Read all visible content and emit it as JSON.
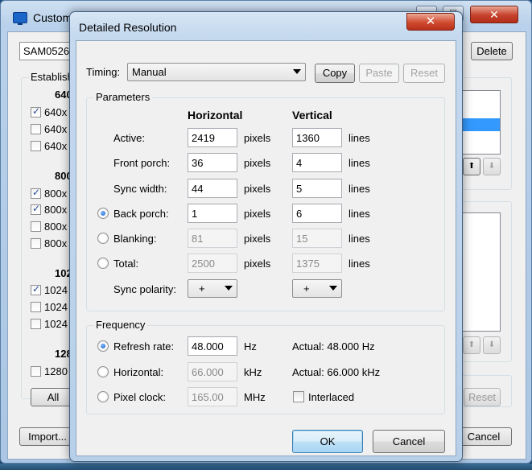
{
  "background_window": {
    "title": "Custom",
    "monitor_combo": "SAM0526",
    "delete_label": "Delete",
    "established_label": "Establish",
    "sections": [
      {
        "heading": "640",
        "items": [
          {
            "label": "640x",
            "checked": true
          },
          {
            "label": "640x",
            "checked": false
          },
          {
            "label": "640x",
            "checked": false
          }
        ]
      },
      {
        "heading": "800",
        "items": [
          {
            "label": "800x",
            "checked": true
          },
          {
            "label": "800x",
            "checked": true
          },
          {
            "label": "800x",
            "checked": false
          },
          {
            "label": "800x",
            "checked": false
          }
        ]
      },
      {
        "heading": "102",
        "items": [
          {
            "label": "1024",
            "checked": true
          },
          {
            "label": "1024",
            "checked": false
          },
          {
            "label": "1024",
            "checked": false
          }
        ]
      },
      {
        "heading": "128",
        "items": [
          {
            "label": "1280",
            "checked": false
          }
        ]
      }
    ],
    "all_label": "All",
    "reset_label": "Reset",
    "import_label": "Import...",
    "cancel_label": "Cancel",
    "up_arrow": "⬆",
    "down_arrow": "⬇"
  },
  "dialog": {
    "title": "Detailed Resolution",
    "close_glyph": "✕",
    "timing": {
      "label": "Timing:",
      "value": "Manual"
    },
    "copy_label": "Copy",
    "paste_label": "Paste",
    "reset_label": "Reset",
    "parameters": {
      "group_label": "Parameters",
      "horizontal_header": "Horizontal",
      "vertical_header": "Vertical",
      "rows": [
        {
          "label": "Active:",
          "h": "2419",
          "h_unit": "pixels",
          "v": "1360",
          "v_unit": "lines",
          "editable": true,
          "radio": null
        },
        {
          "label": "Front porch:",
          "h": "36",
          "h_unit": "pixels",
          "v": "4",
          "v_unit": "lines",
          "editable": true,
          "radio": null
        },
        {
          "label": "Sync width:",
          "h": "44",
          "h_unit": "pixels",
          "v": "5",
          "v_unit": "lines",
          "editable": true,
          "radio": null
        },
        {
          "label": "Back porch:",
          "h": "1",
          "h_unit": "pixels",
          "v": "6",
          "v_unit": "lines",
          "editable": true,
          "radio": "on"
        },
        {
          "label": "Blanking:",
          "h": "81",
          "h_unit": "pixels",
          "v": "15",
          "v_unit": "lines",
          "editable": false,
          "radio": "off"
        },
        {
          "label": "Total:",
          "h": "2500",
          "h_unit": "pixels",
          "v": "1375",
          "v_unit": "lines",
          "editable": false,
          "radio": "off"
        }
      ],
      "sync_polarity_label": "Sync polarity:",
      "h_polarity": "+",
      "v_polarity": "+"
    },
    "frequency": {
      "group_label": "Frequency",
      "refresh": {
        "label": "Refresh rate:",
        "value": "48.000",
        "unit": "Hz",
        "actual": "Actual: 48.000 Hz",
        "selected": true
      },
      "horizontal": {
        "label": "Horizontal:",
        "value": "66.000",
        "unit": "kHz",
        "actual": "Actual: 66.000 kHz",
        "selected": false
      },
      "pixel_clock": {
        "label": "Pixel clock:",
        "value": "165.00",
        "unit": "MHz",
        "selected": false
      },
      "interlaced_label": "Interlaced",
      "interlaced_checked": false
    },
    "ok_label": "OK",
    "cancel_label": "Cancel"
  }
}
